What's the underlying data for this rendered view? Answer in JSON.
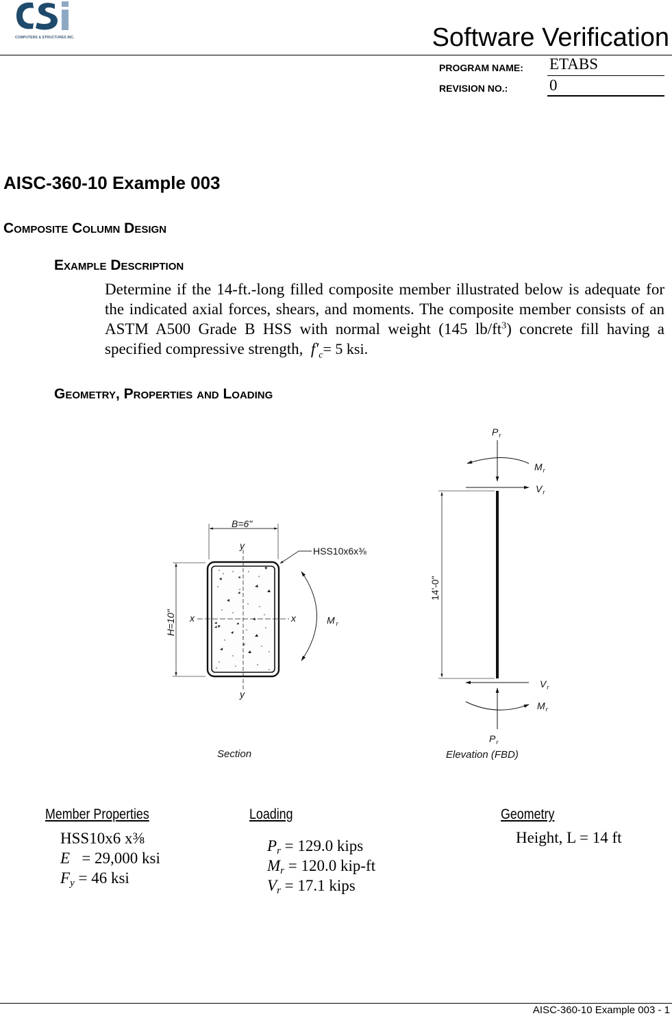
{
  "header": {
    "logo_text": "CSi",
    "logo_subtitle": "COMPUTERS & STRUCTURES INC.",
    "doc_title": "Software Verification",
    "program_name_label": "PROGRAM NAME:",
    "program_name_value": "ETABS",
    "revision_label": "REVISION NO.:",
    "revision_value": "0",
    "brand_color_dark": "#1f4a6b",
    "brand_color_light": "#8fa8c4"
  },
  "main": {
    "title": "AISC-360-10 Example 003",
    "section_title": "Composite Column Design",
    "description_heading": "Example Description",
    "description_text_1": "Determine if the 14-ft.-long filled composite member illustrated below is adequate for the indicated axial forces, shears, and moments. The composite member consists of an ASTM A500 Grade B HSS with normal weight (145 lb/ft",
    "description_sup": "3",
    "description_text_2": ") concrete fill having a specified compressive strength,",
    "fc_symbol": "f",
    "fc_prime": "′",
    "fc_sub": "c",
    "fc_value": "= 5 ksi.",
    "geometry_heading": "Geometry, Properties and Loading"
  },
  "figure": {
    "section": {
      "caption": "Section",
      "width_label": "B=6\"",
      "height_label": "H=10\"",
      "shape_label": "HSS10x6x⅜",
      "x_axis": "x",
      "y_axis": "y",
      "moment_label": "M",
      "moment_sub": "r"
    },
    "elevation": {
      "caption": "Elevation (FBD)",
      "length_label": "14'-0\"",
      "axial_label": "P",
      "moment_label": "M",
      "shear_label": "V",
      "sub": "r"
    }
  },
  "properties": {
    "member_heading": "Member  Properties",
    "member_items": [
      {
        "sym": "",
        "sub": "",
        "text": "HSS10x6 x⅜"
      },
      {
        "sym": "E",
        "sub": "",
        "text": "   = 29,000 ksi"
      },
      {
        "sym": "F",
        "sub": "y",
        "text": " = 46 ksi"
      }
    ],
    "loading_heading": "Loading",
    "loading_items": [
      {
        "sym": "P",
        "sub": "r",
        "text": " = 129.0 kips"
      },
      {
        "sym": "M",
        "sub": "r",
        "text": " = 120.0 kip-ft"
      },
      {
        "sym": "V",
        "sub": "r",
        "text": " = 17.1 kips"
      }
    ],
    "geometry_heading": "Geometry",
    "geometry_items": [
      {
        "text": "Height, L = 14 ft"
      }
    ]
  },
  "footer": {
    "page_label": "AISC-360-10 Example 003 - 1"
  }
}
